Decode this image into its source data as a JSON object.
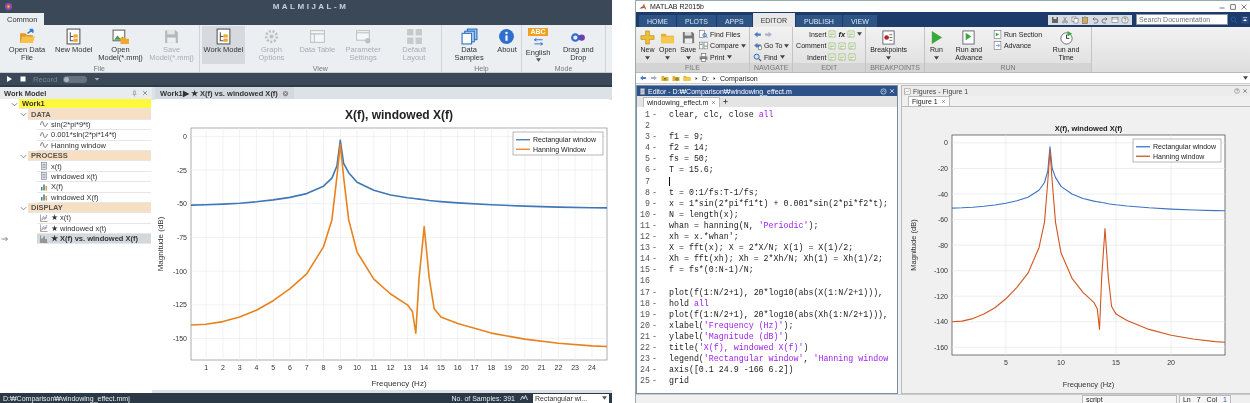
{
  "left_app": {
    "title": "MALMIJAL-M",
    "tabs": [
      {
        "label": "Common",
        "selected": true
      }
    ],
    "ribbon": [
      {
        "label": "File",
        "buttons": [
          {
            "label": "Open Data File",
            "active": false,
            "disabled": false,
            "menu": false
          },
          {
            "label": "New Model",
            "active": false,
            "disabled": false,
            "menu": false
          },
          {
            "label": "Open Model(*.mmj)",
            "active": false,
            "disabled": false,
            "menu": false
          },
          {
            "label": "Save Model(*.mmj)",
            "active": false,
            "disabled": true,
            "menu": false
          }
        ]
      },
      {
        "label": "View",
        "buttons": [
          {
            "label": "Work Model",
            "active": true,
            "disabled": false,
            "menu": false
          },
          {
            "label": "Graph Options",
            "active": false,
            "disabled": true,
            "menu": false
          },
          {
            "label": "Data Table",
            "active": false,
            "disabled": true,
            "menu": false
          },
          {
            "label": "Parameter Settings",
            "active": false,
            "disabled": true,
            "menu": false
          },
          {
            "label": "Default Layout",
            "active": false,
            "disabled": true,
            "menu": false
          }
        ]
      },
      {
        "label": "Help",
        "buttons": [
          {
            "label": "Data Samples",
            "active": false,
            "disabled": false,
            "menu": false
          },
          {
            "label": "About",
            "active": false,
            "disabled": false,
            "menu": false
          }
        ]
      },
      {
        "label": "Mode",
        "buttons": [
          {
            "label": "English",
            "badge": "ABC",
            "active": false,
            "disabled": false,
            "menu": true
          },
          {
            "label": "Drag and Drop",
            "active": false,
            "disabled": false,
            "menu": false
          }
        ]
      }
    ],
    "run_bar": {
      "record": {
        "label": "Record",
        "on": false
      }
    },
    "panel": {
      "title": "Work Model",
      "tree": [
        {
          "label": "Work1",
          "kind": "model",
          "expanded": true,
          "selected": false,
          "children": [
            {
              "label": "DATA",
              "kind": "group",
              "expanded": true,
              "selected": false,
              "children": [
                {
                  "label": "sin(2*pi*9*t)",
                  "kind": "signal",
                  "selected": false
                },
                {
                  "label": "0.001*sin(2*pi*14*t)",
                  "kind": "signal",
                  "selected": false
                },
                {
                  "label": "Hanning window",
                  "kind": "signal",
                  "selected": false
                }
              ]
            },
            {
              "label": "PROCESS",
              "kind": "group",
              "expanded": true,
              "selected": false,
              "children": [
                {
                  "label": "x(t)",
                  "kind": "time-data",
                  "selected": false
                },
                {
                  "label": "windowed x(t)",
                  "kind": "time-data",
                  "selected": false
                },
                {
                  "label": "X(f)",
                  "kind": "spectrum",
                  "selected": false
                },
                {
                  "label": "windowed X(f)",
                  "kind": "spectrum",
                  "selected": false
                }
              ]
            },
            {
              "label": "DISPLAY",
              "kind": "group",
              "expanded": true,
              "selected": false,
              "children": [
                {
                  "label": "★ x(t)",
                  "kind": "plot",
                  "selected": false
                },
                {
                  "label": "★ windowed x(t)",
                  "kind": "plot",
                  "selected": false
                },
                {
                  "label": "★ X(f) vs. windowed X(f)",
                  "kind": "comparison-plot",
                  "selected": true
                }
              ]
            }
          ]
        }
      ]
    },
    "document_tabs": [
      {
        "label": "Work1▶ ★ X(f) vs. windowed X(f)",
        "selected": true
      }
    ],
    "chart_data": {
      "type": "line",
      "title": "X(f), windowed X(f)",
      "xlabel": "Frequency (Hz)",
      "ylabel": "Magnitude (dB)",
      "x": [
        0.1,
        1,
        2,
        3,
        4,
        5,
        6,
        7,
        8,
        8.5,
        8.8,
        9,
        9.2,
        9.5,
        10,
        11,
        12,
        13,
        13.3,
        13.5,
        13.7,
        14,
        14.3,
        14.6,
        15,
        16,
        18,
        20,
        22,
        24,
        24.9
      ],
      "series": [
        {
          "name": "Rectangular window",
          "color": "#3f77b8",
          "values": [
            -51,
            -50.8,
            -50.3,
            -49.6,
            -48.6,
            -47.2,
            -45.3,
            -42.5,
            -37,
            -31,
            -22,
            -3,
            -20,
            -27,
            -34,
            -40,
            -43.5,
            -45.5,
            -46,
            -46.3,
            -46.6,
            -47,
            -47.6,
            -48,
            -48.4,
            -49.4,
            -50.8,
            -51.8,
            -52.5,
            -53,
            -53.1
          ]
        },
        {
          "name": "Hanning Window",
          "color": "#e8821e",
          "values": [
            -140,
            -139.5,
            -137.5,
            -134,
            -129,
            -122,
            -113,
            -102,
            -82,
            -62,
            -30,
            -6,
            -30,
            -62,
            -86,
            -106,
            -117,
            -125,
            -130,
            -146,
            -105,
            -67,
            -105,
            -128,
            -134,
            -139,
            -146,
            -150.5,
            -153.5,
            -155.5,
            -156
          ]
        }
      ],
      "xlim": [
        0.1,
        24.9
      ],
      "ylim": [
        -166,
        6.2
      ],
      "xticks": [
        1,
        2,
        3,
        4,
        5,
        6,
        7,
        8,
        9,
        10,
        11,
        12,
        13,
        14,
        15,
        16,
        17,
        18,
        19,
        20,
        21,
        22,
        23,
        24
      ],
      "yticks": [
        0,
        -25,
        -50,
        -75,
        -100,
        -125,
        -150
      ],
      "grid": true,
      "legend": "upper right"
    },
    "status_bar": {
      "path": "D:₩Comparison₩windowing_effect.mmj",
      "samples": "No. of Samples: 391",
      "series_select": "Rectangular wi..."
    }
  },
  "right_app": {
    "title": "MATLAB R2015b",
    "tabs": [
      {
        "label": "HOME",
        "selected": false
      },
      {
        "label": "PLOTS",
        "selected": false
      },
      {
        "label": "APPS",
        "selected": false
      },
      {
        "label": "EDITOR",
        "selected": true
      },
      {
        "label": "PUBLISH",
        "selected": false
      },
      {
        "label": "VIEW",
        "selected": false
      }
    ],
    "search": {
      "placeholder": "Search Documentation"
    },
    "ribbon": [
      {
        "label": "FILE",
        "items": [
          {
            "label": "New",
            "kind": "large",
            "menu": true
          },
          {
            "label": "Open",
            "kind": "large",
            "menu": true
          },
          {
            "label": "Save",
            "kind": "large",
            "menu": true
          },
          {
            "label": "Find Files",
            "kind": "small",
            "menu": false
          },
          {
            "label": "Compare",
            "kind": "small",
            "menu": true
          },
          {
            "label": "Print",
            "kind": "small",
            "menu": true
          }
        ]
      },
      {
        "label": "NAVIGATE",
        "items": [
          {
            "kind": "nav-arrows",
            "menu": false
          },
          {
            "label": "Go To",
            "kind": "small",
            "menu": true
          },
          {
            "label": "Find",
            "kind": "small",
            "menu": true
          }
        ]
      },
      {
        "label": "EDIT",
        "items": [
          {
            "label": "Insert",
            "kind": "row",
            "extra": "fx",
            "menu": true
          },
          {
            "label": "Comment",
            "kind": "row",
            "menu": false
          },
          {
            "label": "Indent",
            "kind": "row",
            "menu": false
          }
        ]
      },
      {
        "label": "BREAKPOINTS",
        "items": [
          {
            "label": "Breakpoints",
            "kind": "large",
            "menu": true
          }
        ]
      },
      {
        "label": "RUN",
        "items": [
          {
            "label": "Run",
            "kind": "large",
            "menu": true
          },
          {
            "label": "Run and Advance",
            "kind": "large",
            "menu": false
          },
          {
            "label": "Run Section",
            "kind": "small",
            "menu": false
          },
          {
            "label": "Advance",
            "kind": "small",
            "menu": false
          },
          {
            "label": "Run and Time",
            "kind": "large",
            "menu": false
          }
        ]
      }
    ],
    "address": {
      "path": [
        "D:",
        "Comparison"
      ]
    },
    "editor": {
      "title": "Editor - D:₩Comparison₩windowing_effect.m",
      "tabs": [
        {
          "label": "windowing_effect.m",
          "selected": true
        }
      ],
      "lines": [
        {
          "number": "1",
          "marker": "-",
          "cursor": false,
          "code": [
            {
              "text": "clear, clc, close ",
              "kind": "plain"
            },
            {
              "text": "all",
              "kind": "string"
            }
          ]
        },
        {
          "number": "2",
          "cursor": false
        },
        {
          "number": "3",
          "marker": "-",
          "cursor": false,
          "code": [
            {
              "text": "f1 = 9;",
              "kind": "plain"
            }
          ]
        },
        {
          "number": "4",
          "marker": "-",
          "cursor": false,
          "code": [
            {
              "text": "f2 = 14;",
              "kind": "plain"
            }
          ]
        },
        {
          "number": "5",
          "marker": "-",
          "cursor": false,
          "code": [
            {
              "text": "fs = 50;",
              "kind": "plain"
            }
          ]
        },
        {
          "number": "6",
          "marker": "-",
          "cursor": false,
          "code": [
            {
              "text": "T = 15.6;",
              "kind": "plain"
            }
          ]
        },
        {
          "number": "7",
          "cursor": true
        },
        {
          "number": "8",
          "marker": "-",
          "cursor": false,
          "code": [
            {
              "text": "t = 0:1/fs:T-1/fs;",
              "kind": "plain"
            }
          ]
        },
        {
          "number": "9",
          "marker": "-",
          "cursor": false,
          "code": [
            {
              "text": "x = 1*sin(2*pi*f1*t) + 0.001*sin(2*pi*f2*t);",
              "kind": "plain"
            }
          ]
        },
        {
          "number": "10",
          "marker": "-",
          "cursor": false,
          "code": [
            {
              "text": "N = length(x);",
              "kind": "plain"
            }
          ]
        },
        {
          "number": "11",
          "marker": "-",
          "cursor": false,
          "code": [
            {
              "text": "whan = hanning(N, ",
              "kind": "plain"
            },
            {
              "text": "'Periodic'",
              "kind": "string"
            },
            {
              "text": ");",
              "kind": "plain"
            }
          ]
        },
        {
          "number": "12",
          "marker": "-",
          "cursor": false,
          "code": [
            {
              "text": "xh = x.*whan';",
              "kind": "plain"
            }
          ]
        },
        {
          "number": "13",
          "marker": "-",
          "cursor": false,
          "code": [
            {
              "text": "X = fft(x); X = 2*X/N; X(1) = X(1)/2;",
              "kind": "plain"
            }
          ]
        },
        {
          "number": "14",
          "marker": "-",
          "cursor": false,
          "code": [
            {
              "text": "Xh = fft(xh); Xh = 2*Xh/N; Xh(1) = Xh(1)/2;",
              "kind": "plain"
            }
          ]
        },
        {
          "number": "15",
          "marker": "-",
          "cursor": false,
          "code": [
            {
              "text": "f = fs*(0:N-1)/N;",
              "kind": "plain"
            }
          ]
        },
        {
          "number": "16",
          "cursor": false
        },
        {
          "number": "17",
          "marker": "-",
          "cursor": false,
          "code": [
            {
              "text": "plot(f(1:N/2+1), 20*log10(abs(X(1:N/2+1))),",
              "kind": "plain"
            }
          ]
        },
        {
          "number": "18",
          "marker": "-",
          "cursor": false,
          "code": [
            {
              "text": "hold ",
              "kind": "plain"
            },
            {
              "text": "all",
              "kind": "string"
            }
          ]
        },
        {
          "number": "19",
          "marker": "-",
          "cursor": false,
          "code": [
            {
              "text": "plot(f(1:N/2+1), 20*log10(abs(Xh(1:N/2+1))),",
              "kind": "plain"
            }
          ]
        },
        {
          "number": "20",
          "marker": "-",
          "cursor": false,
          "code": [
            {
              "text": "xlabel(",
              "kind": "plain"
            },
            {
              "text": "'Frequency (Hz)'",
              "kind": "string"
            },
            {
              "text": ");",
              "kind": "plain"
            }
          ]
        },
        {
          "number": "21",
          "marker": "-",
          "cursor": false,
          "code": [
            {
              "text": "ylabel(",
              "kind": "plain"
            },
            {
              "text": "'Magnitude (dB)'",
              "kind": "string"
            },
            {
              "text": ")",
              "kind": "plain"
            }
          ]
        },
        {
          "number": "22",
          "marker": "-",
          "cursor": false,
          "code": [
            {
              "text": "title(",
              "kind": "plain"
            },
            {
              "text": "'X(f), windowed X(f)'",
              "kind": "string"
            },
            {
              "text": ")",
              "kind": "plain"
            }
          ]
        },
        {
          "number": "23",
          "marker": "-",
          "cursor": false,
          "code": [
            {
              "text": "legend(",
              "kind": "plain"
            },
            {
              "text": "'Rectangular window'",
              "kind": "string"
            },
            {
              "text": ", ",
              "kind": "plain"
            },
            {
              "text": "'Hanning window",
              "kind": "string"
            }
          ]
        },
        {
          "number": "24",
          "marker": "-",
          "cursor": false,
          "code": [
            {
              "text": "axis([0.1 24.9 -166 6.2])",
              "kind": "plain"
            }
          ]
        },
        {
          "number": "25",
          "marker": "-",
          "cursor": false,
          "code": [
            {
              "text": "grid",
              "kind": "plain"
            }
          ]
        }
      ]
    },
    "figure": {
      "title": "Figures - Figure 1",
      "tabs": [
        {
          "label": "Figure 1",
          "selected": true
        }
      ],
      "chart_data": {
        "type": "line",
        "title": "X(f), windowed X(f)",
        "xlabel": "Frequency (Hz)",
        "ylabel": "Magnitude (dB)",
        "x": [
          0.1,
          1,
          2,
          3,
          4,
          5,
          6,
          7,
          8,
          8.5,
          8.8,
          9,
          9.2,
          9.5,
          10,
          11,
          12,
          13,
          13.3,
          13.5,
          13.7,
          14,
          14.3,
          14.6,
          15,
          16,
          18,
          20,
          22,
          24,
          24.9
        ],
        "series": [
          {
            "name": "Rectangular window",
            "color": "#3b74c4",
            "values": [
              -51,
              -50.8,
              -50.3,
              -49.6,
              -48.6,
              -47.2,
              -45.3,
              -42.5,
              -37,
              -31,
              -22,
              -3,
              -20,
              -27,
              -34,
              -40,
              -43.5,
              -45.5,
              -46,
              -46.3,
              -46.6,
              -47,
              -47.6,
              -48,
              -48.4,
              -49.4,
              -50.8,
              -51.8,
              -52.5,
              -53,
              -53.1
            ]
          },
          {
            "name": "Hanning window",
            "color": "#d2561f",
            "values": [
              -140,
              -139.5,
              -137.5,
              -134,
              -129,
              -122,
              -113,
              -102,
              -82,
              -62,
              -30,
              -6,
              -30,
              -62,
              -86,
              -106,
              -117,
              -125,
              -130,
              -146,
              -105,
              -67,
              -105,
              -128,
              -134,
              -139,
              -146,
              -150.5,
              -153.5,
              -155.5,
              -156
            ]
          }
        ],
        "xlim": [
          0.1,
          24.9
        ],
        "ylim": [
          -166,
          6.2
        ],
        "xticks": [
          5,
          10,
          15,
          20
        ],
        "yticks": [
          0,
          -20,
          -40,
          -60,
          -80,
          -100,
          -120,
          -140,
          -160
        ],
        "grid": true,
        "legend": "upper right"
      }
    },
    "status_bar": {
      "mode": "script",
      "ln_label": "Ln",
      "ln": "7",
      "col_label": "Col",
      "col": "1"
    }
  }
}
